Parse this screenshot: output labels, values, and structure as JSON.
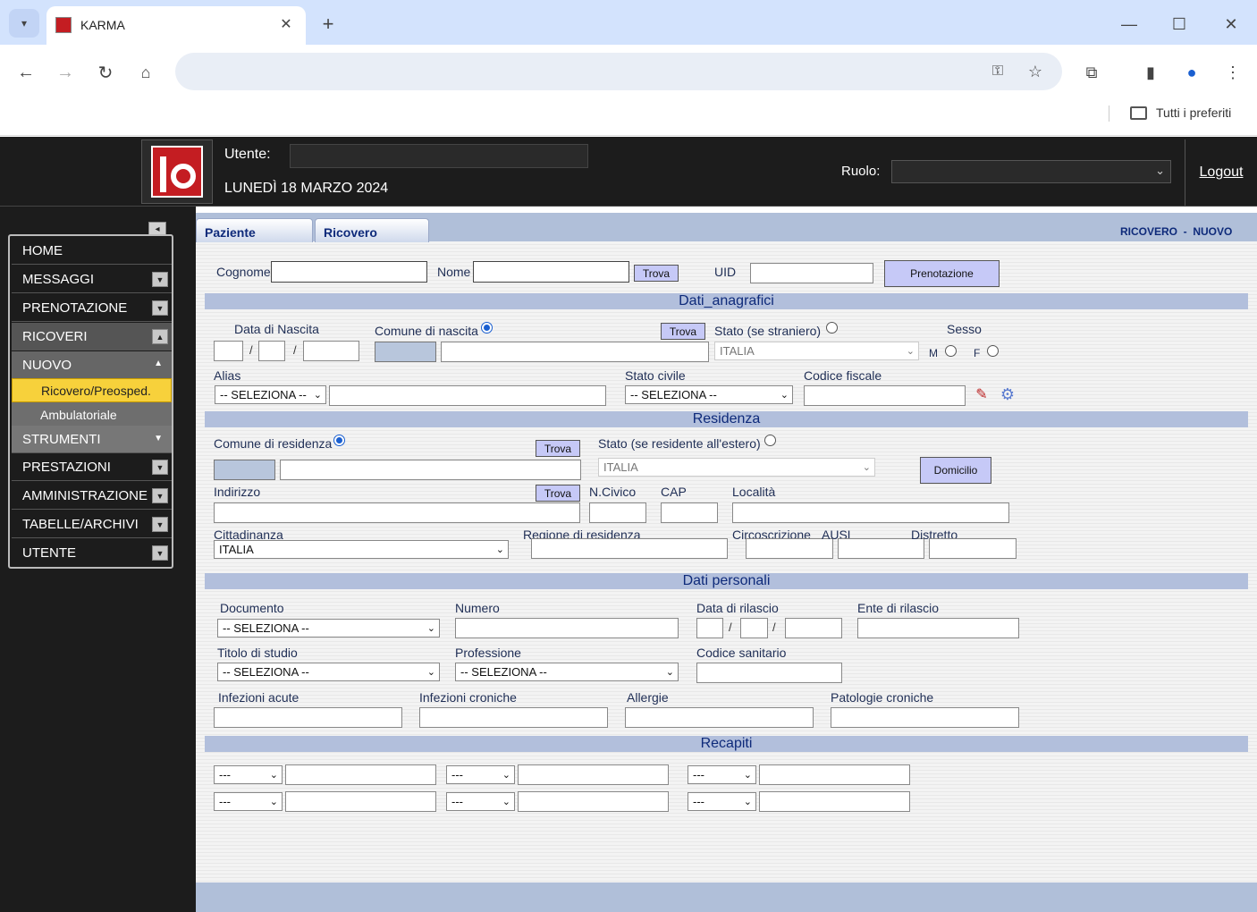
{
  "browser": {
    "tab_title": "KARMA",
    "bookmarks_label": "Tutti i preferiti"
  },
  "header": {
    "user_label": "Utente:",
    "date": "LUNEDÌ 18 MARZO 2024",
    "role_label": "Ruolo:",
    "logout": "Logout"
  },
  "menu": {
    "items": [
      {
        "label": "HOME"
      },
      {
        "label": "MESSAGGI"
      },
      {
        "label": "PRENOTAZIONE"
      },
      {
        "label": "RICOVERI"
      },
      {
        "label": "NUOVO"
      },
      {
        "label": "STRUMENTI"
      },
      {
        "label": "PRESTAZIONI"
      },
      {
        "label": "AMMINISTRAZIONE"
      },
      {
        "label": "TABELLE/ARCHIVI"
      },
      {
        "label": "UTENTE"
      }
    ],
    "sub": [
      "Ricovero/Preosped.",
      "Ambulatoriale"
    ]
  },
  "tabs": [
    "Paziente",
    "Ricovero"
  ],
  "status": "RICOVERO  -  NUOVO",
  "search": {
    "cognome": "Cognome",
    "nome": "Nome",
    "trova": "Trova",
    "uid": "UID",
    "prenotazione": "Prenotazione"
  },
  "sections": {
    "anagrafici": "Dati_anagrafici",
    "residenza": "Residenza",
    "personali": "Dati personali",
    "recapiti": "Recapiti"
  },
  "anagrafici": {
    "data_nascita": "Data di Nascita",
    "comune_nascita": "Comune di nascita",
    "stato_straniero": "Stato (se straniero)",
    "stato_value": "ITALIA",
    "sesso": "Sesso",
    "m": "M",
    "f": "F",
    "alias": "Alias",
    "alias_sel": "-- SELEZIONA --",
    "stato_civile": "Stato civile",
    "stato_civile_sel": "-- SELEZIONA --",
    "codice_fiscale": "Codice fiscale"
  },
  "residenza": {
    "comune": "Comune di residenza",
    "stato_estero": "Stato (se residente all'estero)",
    "stato_value": "ITALIA",
    "domicilio": "Domicilio",
    "indirizzo": "Indirizzo",
    "civico": "N.Civico",
    "cap": "CAP",
    "localita": "Località",
    "cittadinanza": "Cittadinanza",
    "cittadinanza_value": "ITALIA",
    "regione": "Regione di residenza",
    "circoscrizione": "Circoscrizione",
    "ausl": "AUSL",
    "distretto": "Distretto"
  },
  "personali": {
    "documento": "Documento",
    "documento_sel": "-- SELEZIONA --",
    "numero": "Numero",
    "data_rilascio": "Data di rilascio",
    "ente": "Ente di rilascio",
    "titolo": "Titolo di studio",
    "titolo_sel": "-- SELEZIONA --",
    "professione": "Professione",
    "professione_sel": "-- SELEZIONA --",
    "codice_sanitario": "Codice sanitario",
    "inf_acute": "Infezioni acute",
    "inf_croniche": "Infezioni croniche",
    "allergie": "Allergie",
    "patologie": "Patologie croniche"
  },
  "recapiti": {
    "sel": "---"
  },
  "icons": {
    "edit": "edit-icon",
    "gear": "gear-icon"
  }
}
